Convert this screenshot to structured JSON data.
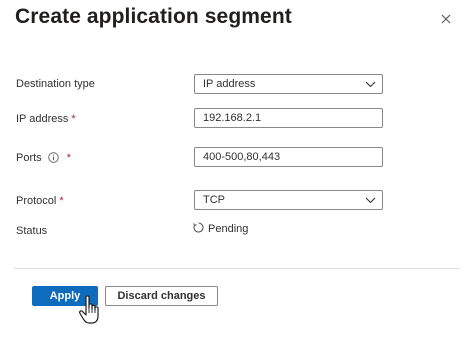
{
  "dialog": {
    "title": "Create application segment"
  },
  "form": {
    "destination_type": {
      "label": "Destination type",
      "value": "IP address",
      "required": false
    },
    "ip_address": {
      "label": "IP address",
      "value": "192.168.2.1",
      "required_mark": "*"
    },
    "ports": {
      "label": "Ports",
      "value": "400-500,80,443",
      "required_mark": "*"
    },
    "protocol": {
      "label": "Protocol",
      "value": "TCP",
      "required_mark": "*"
    },
    "status": {
      "label": "Status",
      "value": "Pending"
    }
  },
  "actions": {
    "apply_label": "Apply",
    "discard_label": "Discard changes"
  },
  "colors": {
    "primary": "#0f6cbd",
    "required": "#a4262c",
    "border": "#8a8886"
  },
  "icons": [
    "close-icon",
    "info-icon",
    "chevron-down-icon",
    "pending-icon",
    "hand-pointer-cursor"
  ]
}
